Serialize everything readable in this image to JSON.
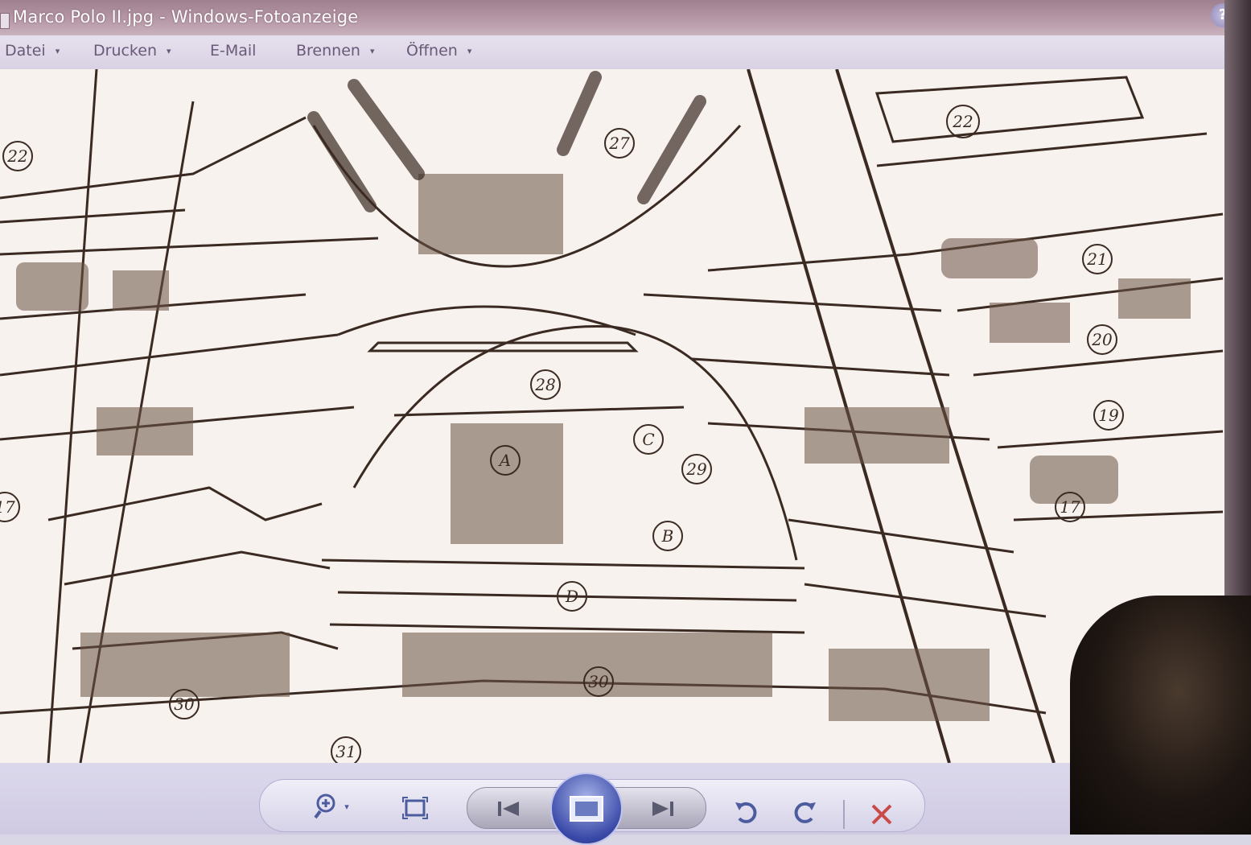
{
  "window": {
    "title": "Marco Polo II.jpg - Windows-Fotoanzeige",
    "help_label": "?"
  },
  "menu": {
    "items": [
      {
        "label": "Datei",
        "dropdown": true
      },
      {
        "label": "Drucken",
        "dropdown": true
      },
      {
        "label": "E-Mail",
        "dropdown": false
      },
      {
        "label": "Brennen",
        "dropdown": true
      },
      {
        "label": "Öffnen",
        "dropdown": true
      }
    ],
    "caret": "▾"
  },
  "image": {
    "labels": [
      "22",
      "22",
      "27",
      "21",
      "20",
      "28",
      "A",
      "C",
      "29",
      "B",
      "D",
      "19",
      "17",
      "30",
      "30",
      "17",
      "31"
    ]
  },
  "toolbar": {
    "icons": [
      "zoom-icon",
      "fit-window-icon",
      "previous-icon",
      "slideshow-icon",
      "next-icon",
      "rotate-left-icon",
      "rotate-right-icon",
      "delete-icon"
    ],
    "zoom_caret": "▾"
  },
  "colors": {
    "title_bar": "#b89aa8",
    "menu_text": "#6a5a78",
    "toolbar_icon": "#4c5c9e",
    "delete": "#c84a4a",
    "drawing_ink": "#3a2a22"
  }
}
